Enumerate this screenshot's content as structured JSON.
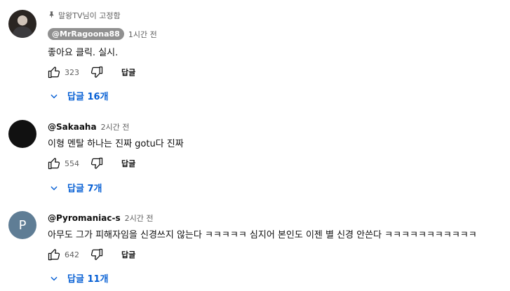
{
  "comments": [
    {
      "pinned_label": "말왕TV님이 고정함",
      "author": "@MrRagoona88",
      "time": "1시간 전",
      "text": "좋아요 클릭. 실시.",
      "likes": "323",
      "reply_label": "답글",
      "replies_label": "답글 16개"
    },
    {
      "author": "@Sakaaha",
      "time": "2시간 전",
      "text": "이형 멘탈 하나는 진짜 gotu다 진짜",
      "likes": "554",
      "reply_label": "답글",
      "replies_label": "답글 7개"
    },
    {
      "avatar_letter": "P",
      "author": "@Pyromaniac-s",
      "time": "2시간 전",
      "text": "아무도 그가 피해자임을 신경쓰지 않는다 ㅋㅋㅋㅋㅋ 심지어 본인도 이젠 별 신경 안쓴다 ㅋㅋㅋㅋㅋㅋㅋㅋㅋㅋㅋ",
      "likes": "642",
      "reply_label": "답글",
      "replies_label": "답글 11개"
    }
  ],
  "colors": {
    "link": "#065fd4",
    "secondary_text": "#606060",
    "author_chip": "#909090"
  }
}
